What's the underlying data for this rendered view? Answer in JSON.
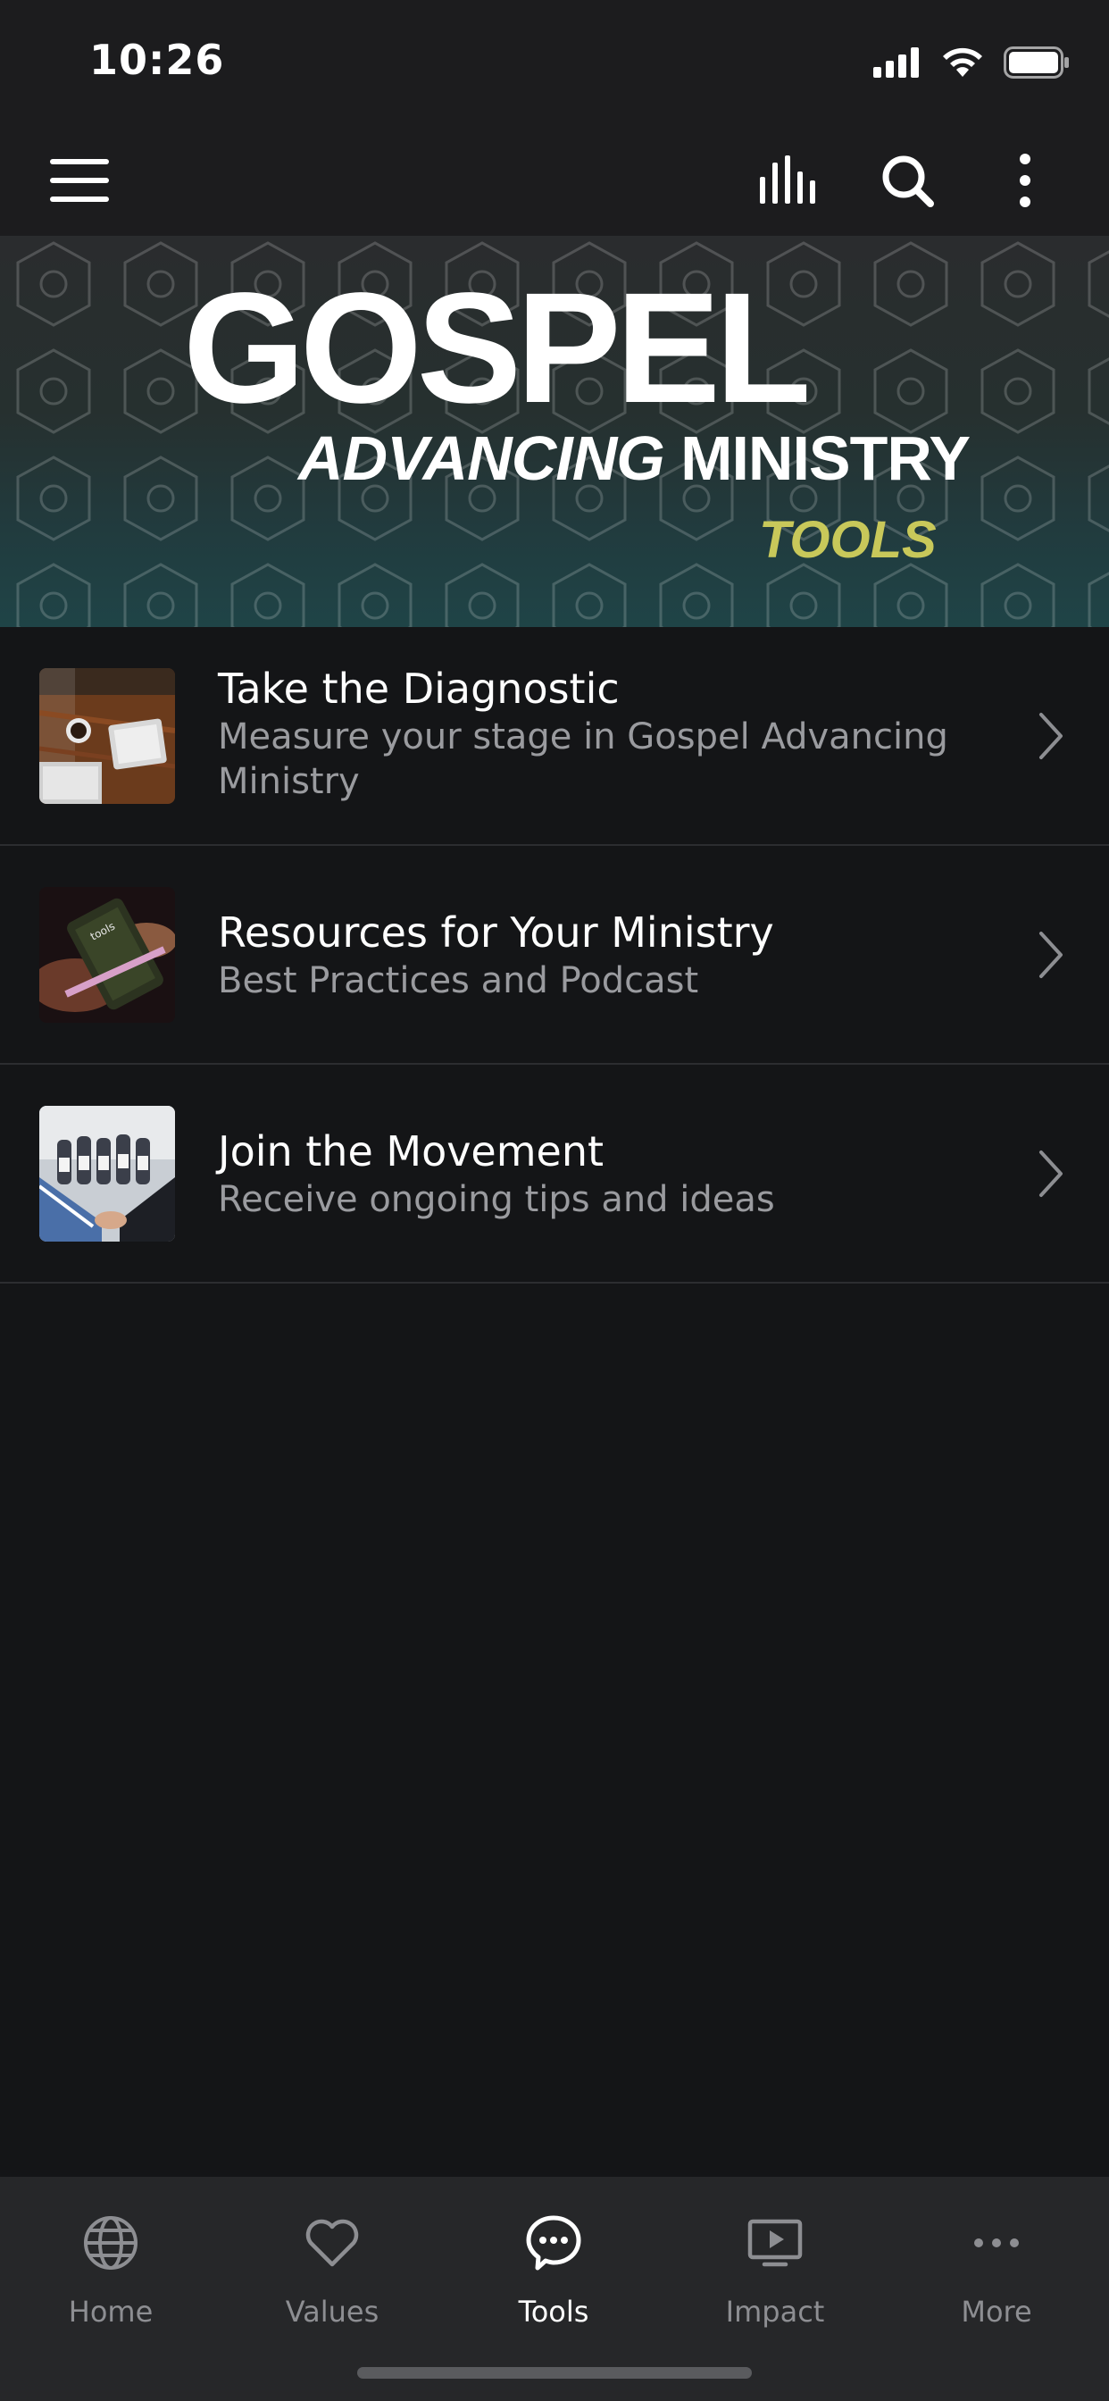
{
  "status_bar": {
    "time": "10:26"
  },
  "app_bar": {
    "icons": [
      "menu-icon",
      "bar-chart-icon",
      "search-icon",
      "more-vertical-icon"
    ]
  },
  "banner": {
    "title": "GOSPEL",
    "subtitle_italic": "ADVANCING",
    "subtitle_regular": " MINISTRY",
    "tag": "TOOLS",
    "tag_color": "#c8c85a"
  },
  "list": {
    "items": [
      {
        "title": "Take the Diagnostic",
        "description": "Measure your stage in Gospel Advancing Ministry",
        "thumb": "desk-laptop-coffee-photo"
      },
      {
        "title": "Resources for Your Ministry",
        "description": "Best Practices and Podcast",
        "thumb": "hands-phone-photo"
      },
      {
        "title": "Join the Movement",
        "description": "Receive ongoing tips and ideas",
        "thumb": "group-handshake-photo"
      }
    ]
  },
  "tab_bar": {
    "tabs": [
      {
        "label": "Home",
        "icon": "globe-icon",
        "active": false
      },
      {
        "label": "Values",
        "icon": "heart-icon",
        "active": false
      },
      {
        "label": "Tools",
        "icon": "chat-bubble-icon",
        "active": true
      },
      {
        "label": "Impact",
        "icon": "video-player-icon",
        "active": false
      },
      {
        "label": "More",
        "icon": "more-horizontal-icon",
        "active": false
      }
    ]
  },
  "colors": {
    "background": "#141517",
    "bar_background": "#1c1c1e",
    "tab_bar_background": "#262729",
    "inactive_tab": "#8d8e92",
    "active_tab": "#ffffff"
  }
}
